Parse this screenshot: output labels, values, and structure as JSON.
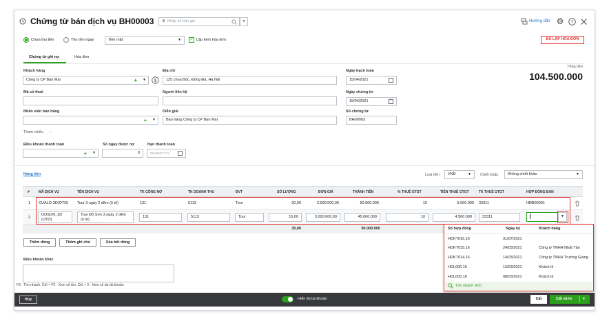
{
  "header": {
    "title": "Chứng từ bán dịch vụ BH00003",
    "quote_placeholder": "Nhập số báo giá",
    "help_label": "Hướng dẫn",
    "status_badge": "ĐÃ LẬP HÓA ĐƠN"
  },
  "payment": {
    "unpaid_label": "Chưa thu tiền",
    "paid_now_label": "Thu tiền ngay",
    "method_value": "Tiền mặt",
    "with_invoice_label": "Lập kèm hóa đơn"
  },
  "tabs": [
    "Chứng từ ghi nợ",
    "Hóa đơn"
  ],
  "total": {
    "label": "Tổng tiền",
    "value": "104.500.000"
  },
  "form": {
    "customer": {
      "label": "Khách hàng",
      "value": "Công ty CP Ban Mai"
    },
    "address": {
      "label": "Địa chỉ",
      "value": "125 chùa Bộc, Đống Đa, Hà Nội"
    },
    "accounting_date": {
      "label": "Ngày hạch toán",
      "value": "15/04/2021"
    },
    "tax_code": {
      "label": "Mã số thuế",
      "value": ""
    },
    "contact": {
      "label": "Người liên hệ",
      "value": ""
    },
    "voucher_date": {
      "label": "Ngày chứng từ",
      "value": "15/04/2021"
    },
    "salesperson": {
      "label": "Nhân viên bán hàng",
      "value": ""
    },
    "description": {
      "label": "Diễn giải",
      "value": "Bán hàng Công ty CP Ban Mai"
    },
    "voucher_no": {
      "label": "Số chứng từ",
      "value": "BH00003"
    },
    "reference_label": "Tham chiếu",
    "reference_more": "...",
    "payment_terms": {
      "label": "Điều khoản thanh toán",
      "value": ""
    },
    "days_allowed": {
      "label": "Số ngày được nợ",
      "value": "0"
    },
    "due_date": {
      "label": "Hạn thanh toán",
      "placeholder": "DD/MM/YYYY"
    }
  },
  "lines_bar": {
    "tab_label": "Hàng tiền",
    "currency_label": "Loại tiền",
    "currency_value": "VND",
    "discount_label": "Chiết khấu",
    "discount_value": "Không chiết khấu"
  },
  "table": {
    "columns": [
      "#",
      "MÃ DỊCH VỤ",
      "TÊN DỊCH VỤ",
      "TK CÔNG NỢ",
      "TK DOANH THU",
      "ĐVT",
      "SỐ LƯỢNG",
      "ĐƠN GIÁ",
      "THÀNH TIỀN",
      "% THUẾ GTGT",
      "TIỀN THUẾ GTGT",
      "TK THUẾ GTGT",
      "HỢP ĐỒNG BÁN"
    ],
    "rows": [
      [
        "1",
        "CUALO-3D(OTO)",
        "Tour 3 ngày 2 đêm (ô tô)",
        "131",
        "5113",
        "Tour",
        "20,00",
        "2.500.000,00",
        "50.000.000",
        "10",
        "5.000.000",
        "33311",
        "HĐB00001"
      ],
      [
        "2",
        "DOSON_3D (OTO)",
        "Tour Đồ Sơn 3 ngày 2 đêm (ô tô)",
        "131",
        "5113",
        "Tour",
        "15,00",
        "3.000.000,00",
        "45.000.000",
        "10",
        "4.500.000",
        "33311",
        ""
      ]
    ],
    "totals": {
      "quantity": "35,00",
      "amount": "95.000.000"
    }
  },
  "row_buttons": [
    "Thêm dòng",
    "Thêm ghi chú",
    "Xóa hết dòng"
  ],
  "other_terms_label": "Điều khoản khác",
  "shortcuts": "F3 - Tìm nhanh, Ctrl + F2 - Xem số tồn, Ctrl + 3 - Xem số dư tài khoản",
  "contract_dropdown": {
    "columns": [
      "Số hợp đồng",
      "Ngày ký",
      "Khách hàng"
    ],
    "rows": [
      [
        "HDKT016.16",
        "31/07/2021",
        ""
      ],
      [
        "HDKT015.16",
        "24/03/2021",
        "Công ty TNHH Nhất Tân"
      ],
      [
        "HDKT014.16",
        "14/03/2021",
        "Công ty TNHH Trường Giang"
      ],
      [
        "HDL006.16",
        "13/03/2021",
        "Khách lẻ"
      ],
      [
        "HDL005.16",
        "08/03/2021",
        "Khách lẻ"
      ]
    ],
    "quick_search": "Tìm nhanh (F3)"
  },
  "footer": {
    "cancel_label": "Hủy",
    "toggle_label": "Hiển thị tài khoản",
    "save_label": "Cất",
    "save_print_label": "Cất và In"
  },
  "colors": {
    "accent": "#2ca01c",
    "highlight": "#e0332f",
    "footer_bg": "#38393d"
  }
}
